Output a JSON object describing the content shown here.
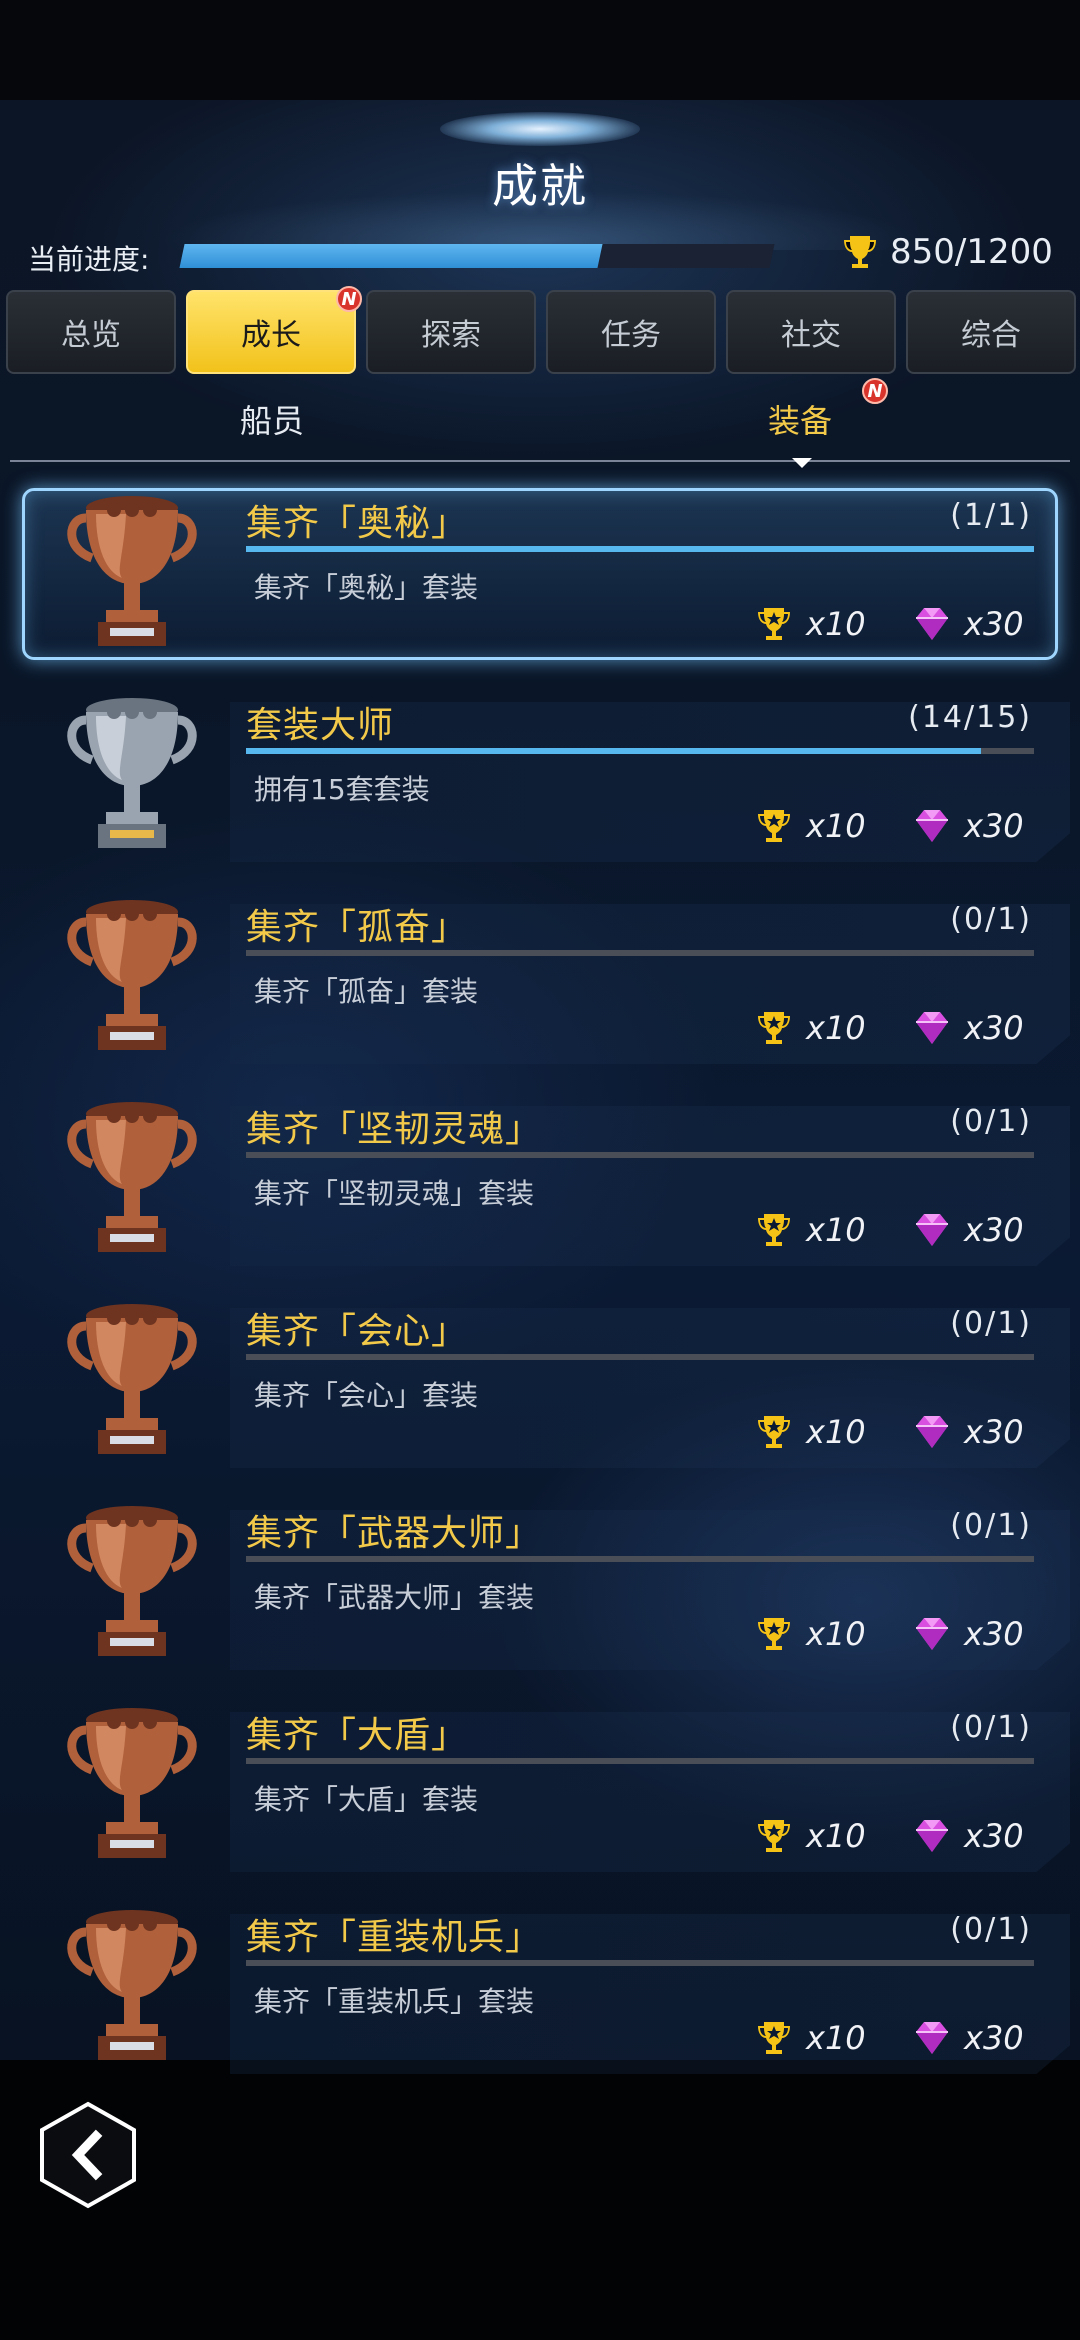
{
  "header": {
    "title": "成就"
  },
  "progress": {
    "label": "当前进度:",
    "fraction": 0.7083,
    "score": "850/1200"
  },
  "tabs": [
    {
      "label": "总览",
      "active": false,
      "badge": ""
    },
    {
      "label": "成长",
      "active": true,
      "badge": "N"
    },
    {
      "label": "探索",
      "active": false,
      "badge": ""
    },
    {
      "label": "任务",
      "active": false,
      "badge": ""
    },
    {
      "label": "社交",
      "active": false,
      "badge": ""
    },
    {
      "label": "综合",
      "active": false,
      "badge": ""
    }
  ],
  "subtabs": [
    {
      "label": "船员",
      "active": false,
      "badge": ""
    },
    {
      "label": "装备",
      "active": true,
      "badge": "N"
    }
  ],
  "achievements": [
    {
      "title": "集齐「奥秘」",
      "count": "(1/1)",
      "progress": 1.0,
      "desc": "集齐「奥秘」套装",
      "trophy": "bronze",
      "trophy_reward": "x10",
      "gem_reward": "x30",
      "highlight": true
    },
    {
      "title": "套装大师",
      "count": "(14/15)",
      "progress": 0.9333,
      "desc": "拥有15套套装",
      "trophy": "silver",
      "trophy_reward": "x10",
      "gem_reward": "x30",
      "highlight": false
    },
    {
      "title": "集齐「孤奋」",
      "count": "(0/1)",
      "progress": 0,
      "desc": "集齐「孤奋」套装",
      "trophy": "bronze",
      "trophy_reward": "x10",
      "gem_reward": "x30",
      "highlight": false
    },
    {
      "title": "集齐「坚韧灵魂」",
      "count": "(0/1)",
      "progress": 0,
      "desc": "集齐「坚韧灵魂」套装",
      "trophy": "bronze",
      "trophy_reward": "x10",
      "gem_reward": "x30",
      "highlight": false
    },
    {
      "title": "集齐「会心」",
      "count": "(0/1)",
      "progress": 0,
      "desc": "集齐「会心」套装",
      "trophy": "bronze",
      "trophy_reward": "x10",
      "gem_reward": "x30",
      "highlight": false
    },
    {
      "title": "集齐「武器大师」",
      "count": "(0/1)",
      "progress": 0,
      "desc": "集齐「武器大师」套装",
      "trophy": "bronze",
      "trophy_reward": "x10",
      "gem_reward": "x30",
      "highlight": false
    },
    {
      "title": "集齐「大盾」",
      "count": "(0/1)",
      "progress": 0,
      "desc": "集齐「大盾」套装",
      "trophy": "bronze",
      "trophy_reward": "x10",
      "gem_reward": "x30",
      "highlight": false
    },
    {
      "title": "集齐「重装机兵」",
      "count": "(0/1)",
      "progress": 0,
      "desc": "集齐「重装机兵」套装",
      "trophy": "bronze",
      "trophy_reward": "x10",
      "gem_reward": "x30",
      "highlight": false
    }
  ],
  "icons": {
    "back": "back-chevron-icon",
    "trophy": "trophy-icon",
    "gem": "gem-icon"
  },
  "colors": {
    "accent_yellow": "#f3c94a",
    "progress_blue": "#57b8f0",
    "gem_purple": "#d94fe0",
    "badge_red": "#d9342b"
  }
}
